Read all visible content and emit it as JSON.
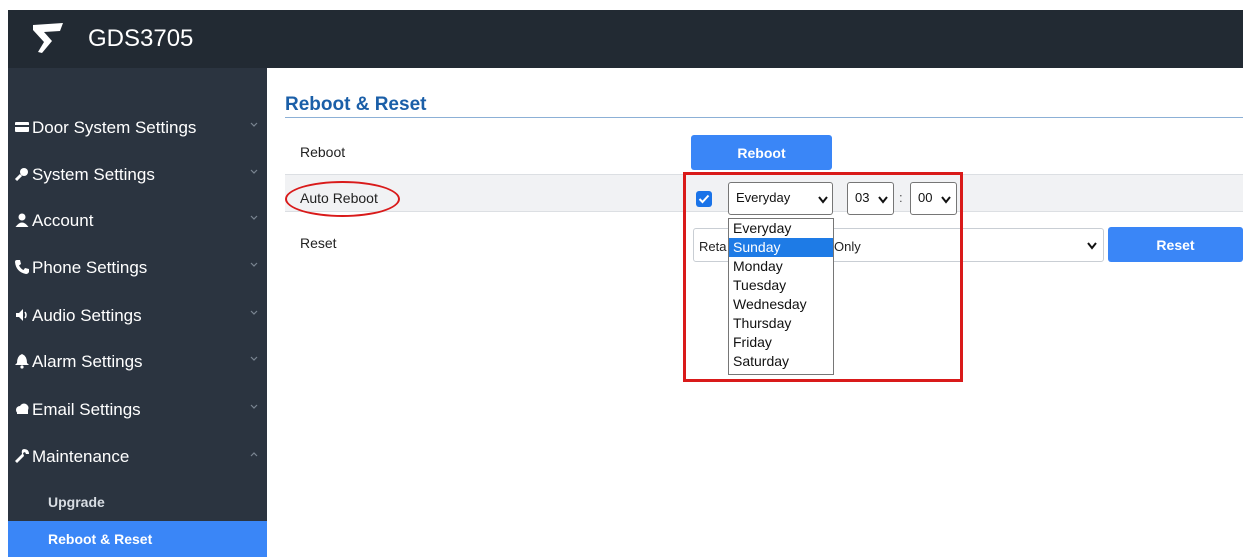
{
  "app": {
    "title": "GDS3705",
    "logo_icon": "grandstream-logo-icon"
  },
  "sidebar": {
    "items": [
      {
        "label": "Door System Settings",
        "icon": "card-icon",
        "expanded": false
      },
      {
        "label": "System Settings",
        "icon": "key-icon",
        "expanded": false
      },
      {
        "label": "Account",
        "icon": "person-icon",
        "expanded": false
      },
      {
        "label": "Phone Settings",
        "icon": "phone-icon",
        "expanded": false
      },
      {
        "label": "Audio Settings",
        "icon": "speaker-icon",
        "expanded": false
      },
      {
        "label": "Alarm Settings",
        "icon": "bell-icon",
        "expanded": false
      },
      {
        "label": "Email Settings",
        "icon": "cloud-icon",
        "expanded": false
      },
      {
        "label": "Maintenance",
        "icon": "wrench-icon",
        "expanded": true
      }
    ],
    "subitems": [
      {
        "label": "Upgrade",
        "active": false
      },
      {
        "label": "Reboot & Reset",
        "active": true
      }
    ]
  },
  "main": {
    "title": "Reboot & Reset",
    "reboot": {
      "label": "Reboot",
      "button": "Reboot"
    },
    "auto_reboot": {
      "label": "Auto Reboot",
      "enabled": true,
      "day_value": "Everyday",
      "hour_value": "03",
      "separator": ":",
      "minute_value": "00",
      "day_options": [
        "Everyday",
        "Sunday",
        "Monday",
        "Tuesday",
        "Wednesday",
        "Thursday",
        "Friday",
        "Saturday"
      ],
      "highlighted_option": "Sunday"
    },
    "reset": {
      "label": "Reset",
      "select_left": "Reta",
      "select_right": "Only",
      "button": "Reset"
    }
  },
  "colors": {
    "topbar": "#222a33",
    "sidebar": "#2b3440",
    "accent": "#3a86f7",
    "title": "#1b5fa8",
    "annotation": "#d91a1a"
  }
}
